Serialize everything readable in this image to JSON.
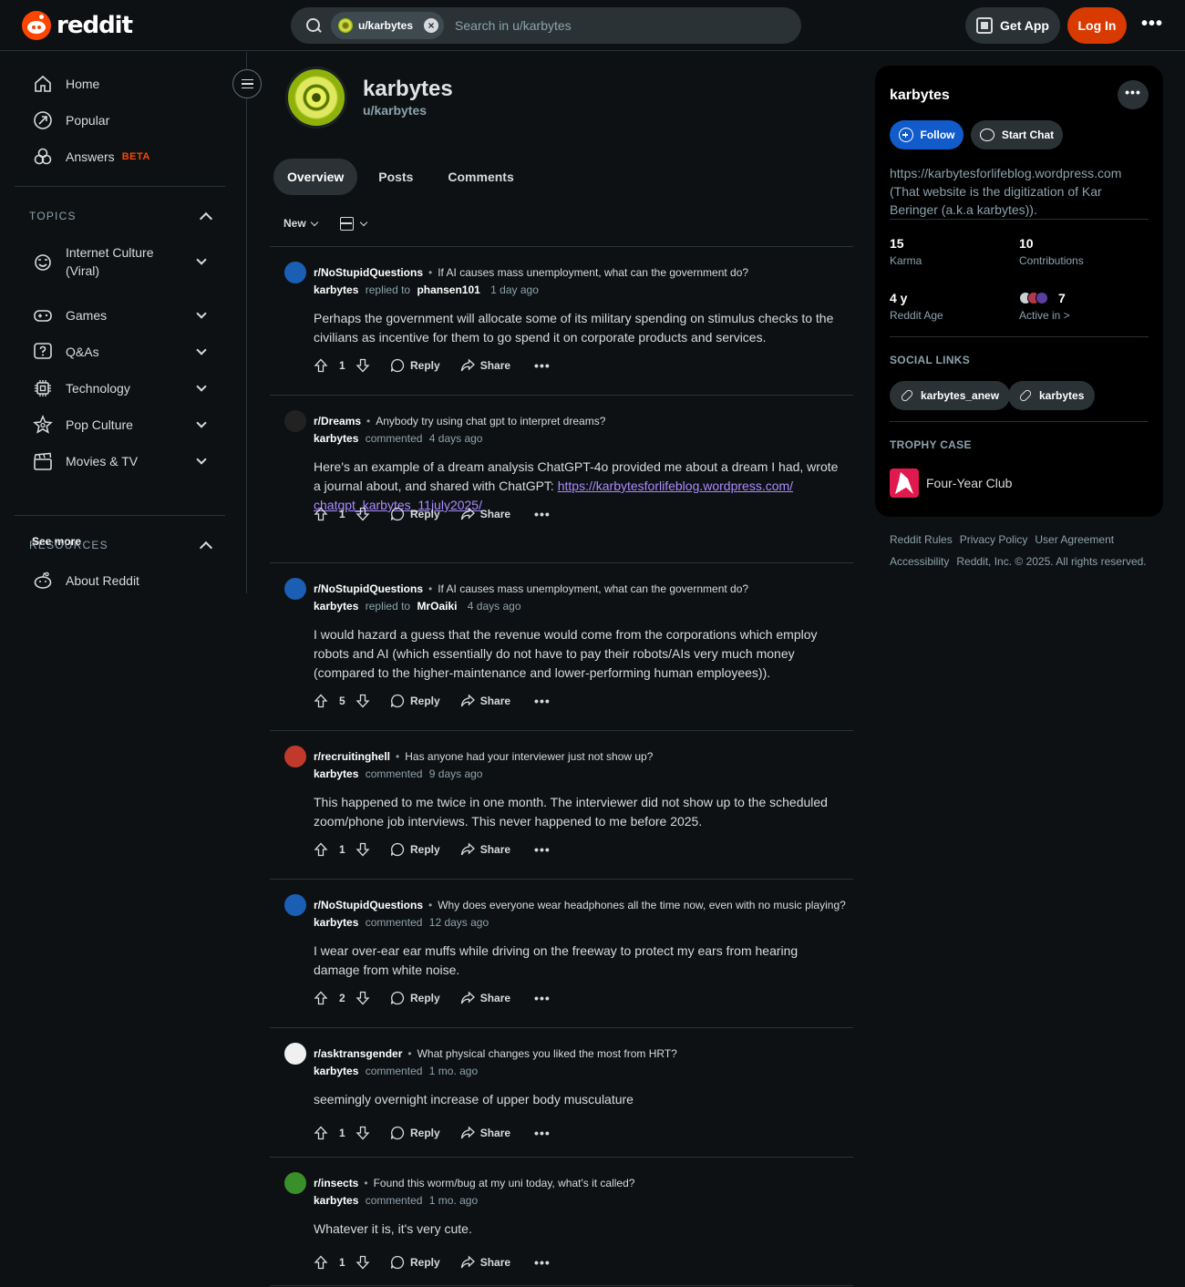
{
  "header": {
    "logo_text": "reddit",
    "search_chip": "u/karbytes",
    "search_placeholder": "Search in u/karbytes",
    "get_app": "Get App",
    "login": "Log In",
    "more": "•••"
  },
  "sidebar": {
    "nav": [
      {
        "label": "Home",
        "icon": "home-icon"
      },
      {
        "label": "Popular",
        "icon": "popular-icon"
      },
      {
        "label": "Answers",
        "icon": "answers-icon",
        "badge": "BETA"
      }
    ],
    "topics_heading": "TOPICS",
    "topics": [
      {
        "label": "Internet Culture (Viral)",
        "icon": "viral-icon"
      },
      {
        "label": "Games",
        "icon": "gamepad-icon"
      },
      {
        "label": "Q&As",
        "icon": "question-icon"
      },
      {
        "label": "Technology",
        "icon": "chip-icon"
      },
      {
        "label": "Pop Culture",
        "icon": "star-icon"
      },
      {
        "label": "Movies & TV",
        "icon": "clapper-icon"
      }
    ],
    "see_more": "See more",
    "resources_heading": "RESOURCES",
    "resources": [
      {
        "label": "About Reddit",
        "icon": "reddit-icon"
      }
    ]
  },
  "profile": {
    "name": "karbytes",
    "handle": "u/karbytes",
    "tabs": [
      "Overview",
      "Posts",
      "Comments"
    ],
    "sort": "New"
  },
  "actions": {
    "reply": "Reply",
    "share": "Share",
    "more": "•••"
  },
  "comments": [
    {
      "sub": "r/NoStupidQuestions",
      "title": "If AI causes mass unemployment, what can the government do?",
      "author": "karbytes",
      "verb": "replied to",
      "target": "phansen101",
      "time": "1 day ago",
      "body": "Perhaps the government will allocate some of its military spending on stimulus checks to the civilians as incentive for them to go spend it on corporate products and services.",
      "score": "1",
      "avatar_color": "#1a5fb4"
    },
    {
      "sub": "r/Dreams",
      "title": "Anybody try using chat gpt to interpret dreams?",
      "author": "karbytes",
      "verb": "commented",
      "target": "",
      "time": "4 days ago",
      "body": "Here's an example of a dream analysis ChatGPT-4o provided me about a dream I had, wrote a journal about, and shared with ChatGPT: ",
      "link": "https://karbytesforlifeblog.wordpress.com/ chatgpt_karbytes_11july2025/",
      "score": "1",
      "avatar_color": "#222222"
    },
    {
      "sub": "r/NoStupidQuestions",
      "title": "If AI causes mass unemployment, what can the government do?",
      "author": "karbytes",
      "verb": "replied to",
      "target": "MrOaiki",
      "time": "4 days ago",
      "body": "I would hazard a guess that the revenue would come from the corporations which employ robots and AI (which essentially do not have to pay their robots/AIs very much money (compared to the higher-maintenance and lower-performing human employees)).",
      "score": "5",
      "avatar_color": "#1a5fb4"
    },
    {
      "sub": "r/recruitinghell",
      "title": "Has anyone had your interviewer just not show up?",
      "author": "karbytes",
      "verb": "commented",
      "target": "",
      "time": "9 days ago",
      "body": "This happened to me twice in one month. The interviewer did not show up to the scheduled zoom/phone job interviews. This never happened to me before 2025.",
      "score": "1",
      "avatar_color": "#c0392b"
    },
    {
      "sub": "r/NoStupidQuestions",
      "title": "Why does everyone wear headphones all the time now, even with no music playing?",
      "author": "karbytes",
      "verb": "commented",
      "target": "",
      "time": "12 days ago",
      "body": "I wear over-ear ear muffs while driving on the freeway to protect my ears from hearing damage from white noise.",
      "score": "2",
      "avatar_color": "#1a5fb4"
    },
    {
      "sub": "r/asktransgender",
      "title": "What physical changes you liked the most from HRT?",
      "author": "karbytes",
      "verb": "commented",
      "target": "",
      "time": "1 mo. ago",
      "body": "seemingly overnight increase of upper body musculature",
      "score": "1",
      "avatar_color": "#f0f0f0"
    },
    {
      "sub": "r/insects",
      "title": "Found this worm/bug at my uni today, what's it called?",
      "author": "karbytes",
      "verb": "commented",
      "target": "",
      "time": "1 mo. ago",
      "body": "Whatever it is, it's very cute.",
      "score": "1",
      "avatar_color": "#3a8f2a"
    }
  ],
  "panel": {
    "name": "karbytes",
    "more": "•••",
    "follow": "Follow",
    "chat": "Start Chat",
    "bio": "https://karbytesforlifeblog.wordpress.com (That website is the digitization of Kar Beringer (a.k.a karbytes)).",
    "stats": [
      {
        "value": "15",
        "label": "Karma"
      },
      {
        "value": "10",
        "label": "Contributions"
      },
      {
        "value": "4 y",
        "label": "Reddit Age"
      },
      {
        "value": "7",
        "label": "Active in >"
      }
    ],
    "social_heading": "SOCIAL LINKS",
    "social": [
      "karbytes_anew",
      "karbytes"
    ],
    "trophy_heading": "TROPHY CASE",
    "trophy": "Four-Year Club"
  },
  "footer": {
    "row1": [
      "Reddit Rules",
      "Privacy Policy",
      "User Agreement"
    ],
    "row2": [
      "Accessibility",
      "Reddit, Inc. © 2025. All rights reserved."
    ]
  },
  "colors": {
    "accent": "#ff4500",
    "login": "#d93a00",
    "follow": "#115bca",
    "link": "#a98bff"
  }
}
